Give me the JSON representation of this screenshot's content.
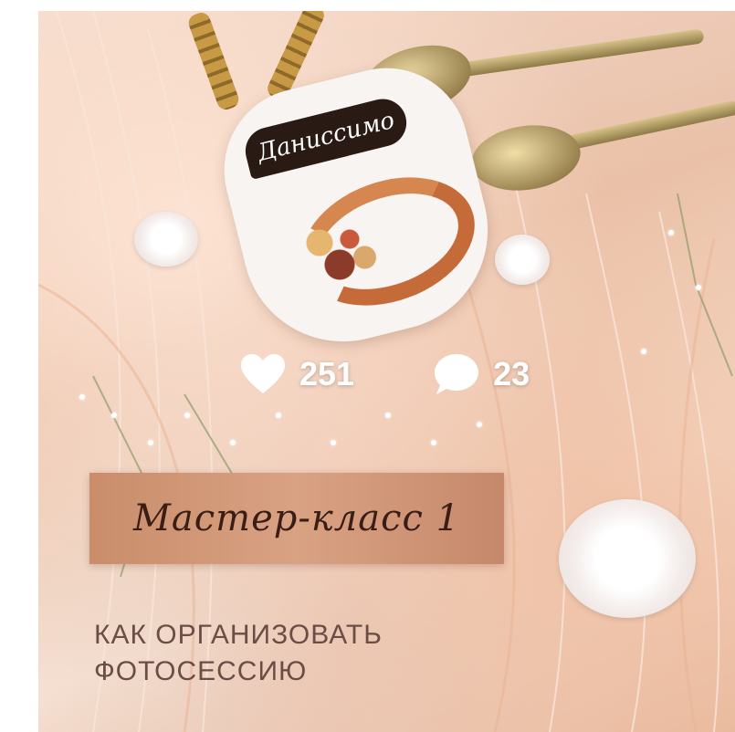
{
  "post": {
    "brand_label": "Даниссимо",
    "likes": "251",
    "comments": "23",
    "title": "Мастер-класс 1",
    "subtitle": "КАК ОРГАНИЗОВАТЬ ФОТОСЕССИЮ"
  },
  "icons": {
    "like": "heart-icon",
    "comment": "speech-bubble-icon"
  },
  "colors": {
    "banner": "#d9a283",
    "title_text": "#3a1e16",
    "subtitle_text": "#6b4d46",
    "stats_text": "#ffffff"
  }
}
